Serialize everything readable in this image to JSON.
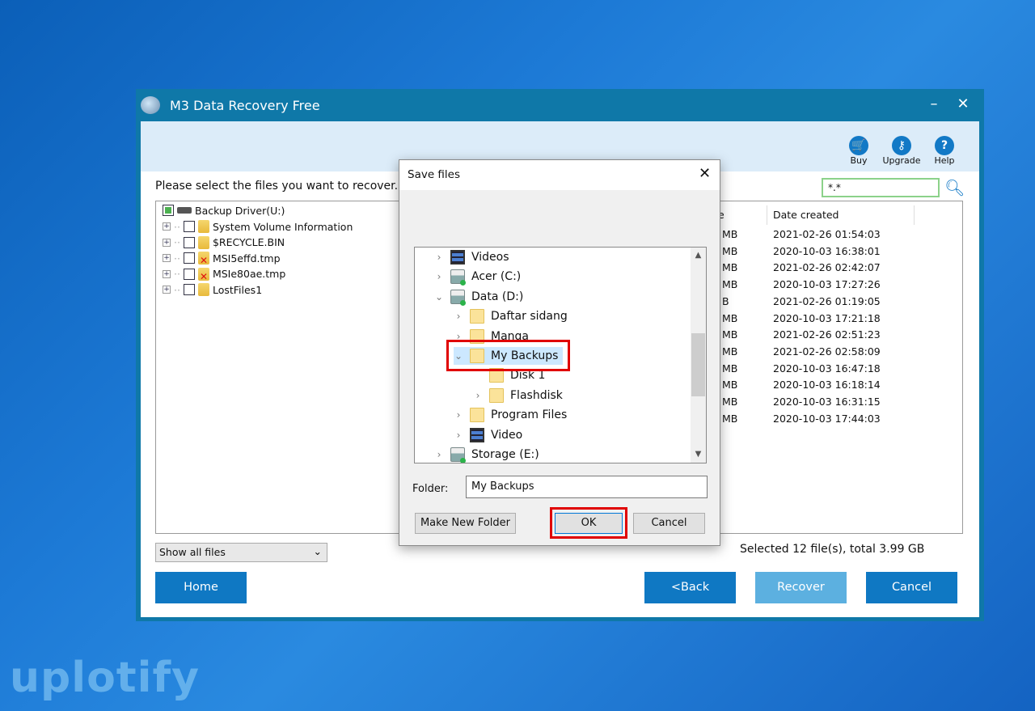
{
  "window": {
    "title": "M3 Data Recovery Free",
    "minimize": "–",
    "close": "✕"
  },
  "toolbar": {
    "buy": "Buy",
    "upgrade": "Upgrade",
    "help": "Help"
  },
  "prompt": "Please select the files you want to recover.",
  "search": {
    "value": "*.*"
  },
  "tree": {
    "root": "Backup Driver(U:)",
    "items": [
      {
        "label": "System Volume Information",
        "deleted": false
      },
      {
        "label": "$RECYCLE.BIN",
        "deleted": false
      },
      {
        "label": "MSI5effd.tmp",
        "deleted": true
      },
      {
        "label": "MSIe80ae.tmp",
        "deleted": true
      },
      {
        "label": "LostFiles1",
        "deleted": false
      }
    ]
  },
  "file_list": {
    "header_size_fragment": "e",
    "header_date": "Date created",
    "rows": [
      {
        "size": "MB",
        "date": "2021-02-26 01:54:03"
      },
      {
        "size": "MB",
        "date": "2020-10-03 16:38:01"
      },
      {
        "size": "MB",
        "date": "2021-02-26 02:42:07"
      },
      {
        "size": "MB",
        "date": "2020-10-03 17:27:26"
      },
      {
        "size": "B",
        "date": "2021-02-26 01:19:05"
      },
      {
        "size": "MB",
        "date": "2020-10-03 17:21:18"
      },
      {
        "size": "MB",
        "date": "2021-02-26 02:51:23"
      },
      {
        "size": "MB",
        "date": "2021-02-26 02:58:09"
      },
      {
        "size": "MB",
        "date": "2020-10-03 16:47:18"
      },
      {
        "size": "MB",
        "date": "2020-10-03 16:18:14"
      },
      {
        "size": "MB",
        "date": "2020-10-03 16:31:15"
      },
      {
        "size": "MB",
        "date": "2020-10-03 17:44:03"
      }
    ]
  },
  "filter": {
    "selected": "Show all files"
  },
  "status": "Selected 12 file(s), total 3.99 GB",
  "buttons": {
    "home": "Home",
    "back": "<Back",
    "recover": "Recover",
    "cancel": "Cancel"
  },
  "dialog": {
    "title": "Save files",
    "folder_label": "Folder:",
    "folder_value": "My Backups",
    "make_new_folder": "Make New Folder",
    "ok": "OK",
    "cancel": "Cancel",
    "nodes": [
      {
        "label": "Videos",
        "level": 0,
        "icon": "video",
        "chevron": "right"
      },
      {
        "label": "Acer (C:)",
        "level": 0,
        "icon": "drive",
        "chevron": "right"
      },
      {
        "label": "Data (D:)",
        "level": 0,
        "icon": "drive",
        "chevron": "down"
      },
      {
        "label": "Daftar sidang",
        "level": 1,
        "icon": "folder",
        "chevron": "right"
      },
      {
        "label": "Manga",
        "level": 1,
        "icon": "folder",
        "chevron": "right"
      },
      {
        "label": "My Backups",
        "level": 1,
        "icon": "folder",
        "chevron": "down",
        "selected": true
      },
      {
        "label": "Disk 1",
        "level": 2,
        "icon": "folder",
        "chevron": "none"
      },
      {
        "label": "Flashdisk",
        "level": 2,
        "icon": "folder",
        "chevron": "right"
      },
      {
        "label": "Program Files",
        "level": 1,
        "icon": "folder",
        "chevron": "right"
      },
      {
        "label": "Video",
        "level": 1,
        "icon": "video",
        "chevron": "right"
      },
      {
        "label": "Storage (E:)",
        "level": 0,
        "icon": "drive",
        "chevron": "right"
      }
    ]
  },
  "highlight_color": "#e00000",
  "watermark": "uplotify"
}
